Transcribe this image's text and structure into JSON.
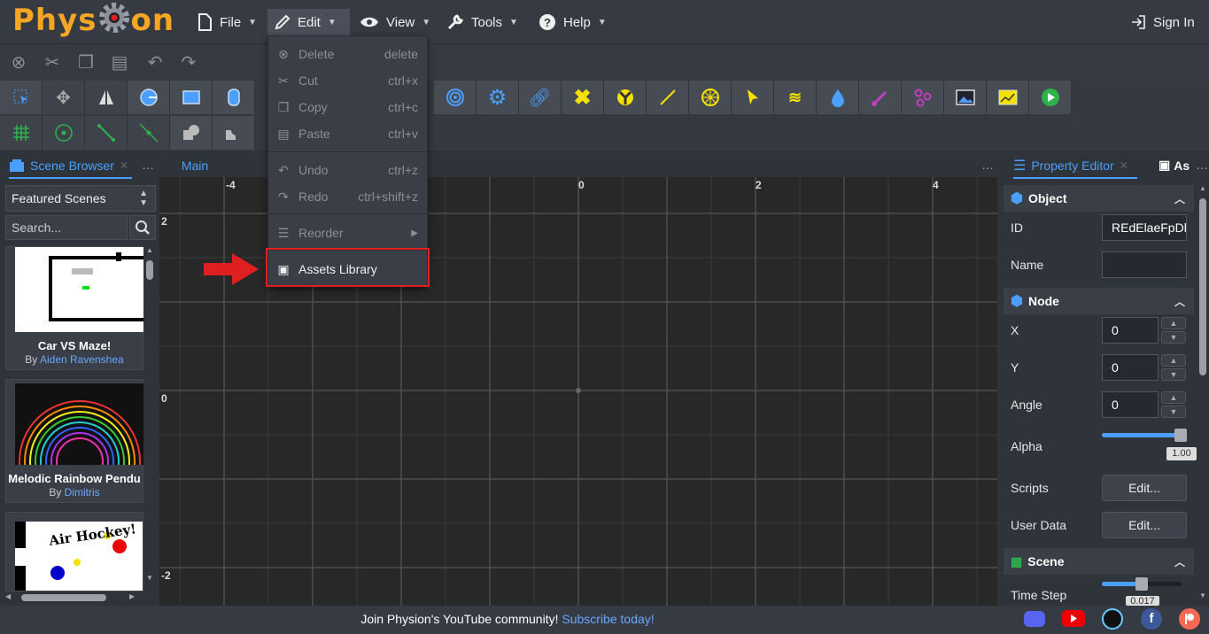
{
  "app": {
    "logo": "Physion"
  },
  "menu": {
    "file": "File",
    "edit": "Edit",
    "view": "View",
    "tools": "Tools",
    "help": "Help",
    "sign_in": "Sign In"
  },
  "edit_menu": {
    "delete": {
      "label": "Delete",
      "shortcut": "delete"
    },
    "cut": {
      "label": "Cut",
      "shortcut": "ctrl+x"
    },
    "copy": {
      "label": "Copy",
      "shortcut": "ctrl+c"
    },
    "paste": {
      "label": "Paste",
      "shortcut": "ctrl+v"
    },
    "undo": {
      "label": "Undo",
      "shortcut": "ctrl+z"
    },
    "redo": {
      "label": "Redo",
      "shortcut": "ctrl+shift+z"
    },
    "reorder": {
      "label": "Reorder"
    },
    "assets": {
      "label": "Assets Library"
    }
  },
  "scene_browser": {
    "tab": "Scene Browser",
    "dropdown": "Featured Scenes",
    "search_placeholder": "Search...",
    "scenes": [
      {
        "title": "Car VS Maze!",
        "by": "By ",
        "author": "Aiden Ravenshea"
      },
      {
        "title": "Melodic Rainbow Pendu",
        "by": "By ",
        "author": "Dimitris"
      },
      {
        "title": "Air Hockey!",
        "by": "",
        "author": ""
      }
    ]
  },
  "canvas": {
    "tab": "Main",
    "x_ticks": [
      "-4",
      "0",
      "2",
      "4"
    ],
    "y_ticks": [
      "2",
      "0",
      "-2"
    ]
  },
  "property_editor": {
    "tab": "Property Editor",
    "tab2": "As",
    "object": {
      "header": "Object",
      "id_label": "ID",
      "id_value": "REdElaeFpDl",
      "name_label": "Name",
      "name_value": ""
    },
    "node": {
      "header": "Node",
      "x_label": "X",
      "x_value": "0",
      "y_label": "Y",
      "y_value": "0",
      "angle_label": "Angle",
      "angle_value": "0",
      "alpha_label": "Alpha",
      "alpha_value": "1.00",
      "alpha_fraction": 1.0,
      "scripts_label": "Scripts",
      "scripts_btn": "Edit...",
      "userdata_label": "User Data",
      "userdata_btn": "Edit..."
    },
    "scene": {
      "header": "Scene",
      "timestep_label": "Time Step",
      "timestep_value": "0.017"
    }
  },
  "footer": {
    "text": "Join Physion's YouTube community!",
    "link": "Subscribe today!"
  },
  "colors": {
    "accent": "#4a9fff",
    "logo": "#f5a623",
    "highlight": "#e02020"
  }
}
